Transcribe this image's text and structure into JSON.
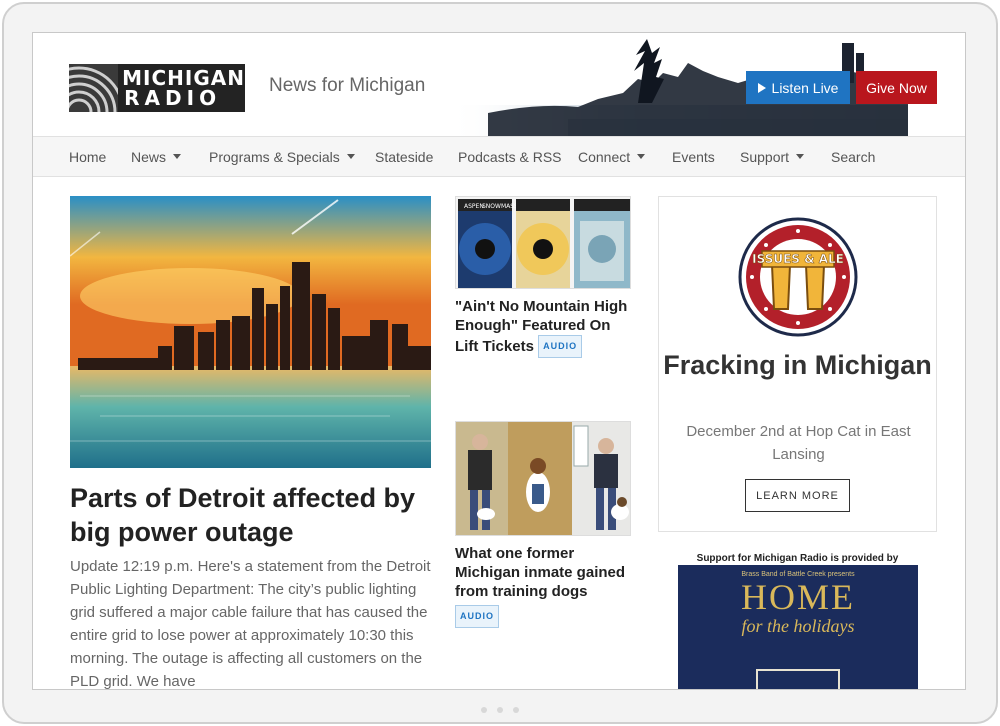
{
  "header": {
    "logo_line1": "MICHIGAN",
    "logo_line2": "RADIO",
    "tagline": "News for Michigan",
    "listen_label": "Listen Live",
    "give_label": "Give Now"
  },
  "nav": {
    "items": [
      {
        "label": "Home",
        "dropdown": false
      },
      {
        "label": "News",
        "dropdown": true
      },
      {
        "label": "Programs & Specials",
        "dropdown": true
      },
      {
        "label": "Stateside",
        "dropdown": false
      },
      {
        "label": "Podcasts & RSS",
        "dropdown": false
      },
      {
        "label": "Connect",
        "dropdown": true
      },
      {
        "label": "Events",
        "dropdown": false
      },
      {
        "label": "Support",
        "dropdown": true
      },
      {
        "label": "Search",
        "dropdown": false
      }
    ]
  },
  "hero": {
    "title": "Parts of Detroit affected by big power outage",
    "body": "Update 12:19 p.m. Here's a statement from the Detroit Public Lighting Department: The city’s public lighting grid suffered a major cable failure that has caused the entire grid to lose power at approximately 10:30 this morning. The outage is affecting all customers on the PLD grid. We have"
  },
  "stories": [
    {
      "title": "\"Ain't No Mountain High Enough\" Featured On Lift Tickets",
      "tag": "AUDIO"
    },
    {
      "title": "What one former Michigan inmate gained from training dogs",
      "tag": "AUDIO"
    }
  ],
  "promo": {
    "badge_text": "ISSUES & ALE",
    "title": "Fracking in Michigan",
    "subtitle": "December 2nd at Hop Cat in East Lansing",
    "button_label": "LEARN MORE"
  },
  "ad": {
    "label": "Support for Michigan Radio is provided by",
    "small": "Brass Band of Battle Creek presents",
    "home": "HOME",
    "holidays": "for the holidays"
  },
  "ticket_labels": [
    "ASPEN",
    "SNOWMASS"
  ],
  "colors": {
    "accent_blue": "#1f74c2",
    "give_red": "#b9161d",
    "text_dark": "#222222"
  }
}
